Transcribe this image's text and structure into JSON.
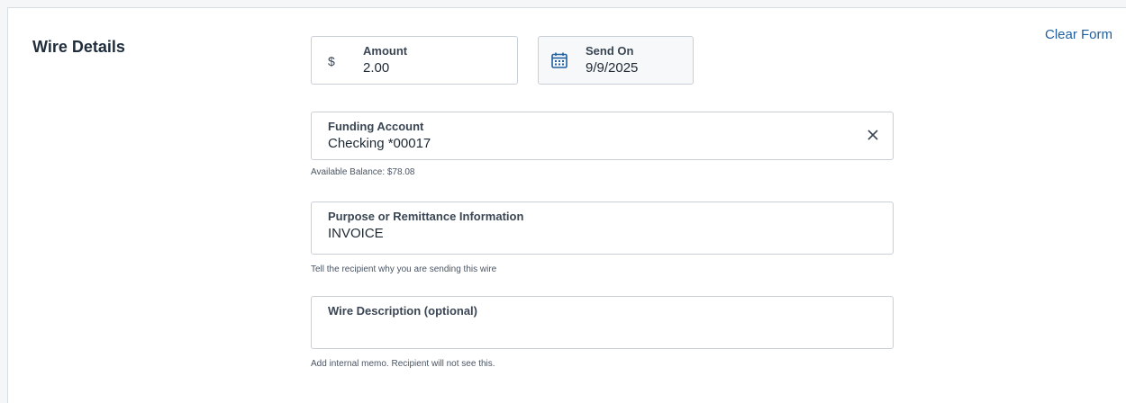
{
  "section": {
    "title": "Wire Details",
    "clear_label": "Clear Form"
  },
  "amount": {
    "prefix": "$",
    "label": "Amount",
    "value": "2.00"
  },
  "send_on": {
    "label": "Send On",
    "value": "9/9/2025",
    "icon": "calendar-icon"
  },
  "funding": {
    "label": "Funding Account",
    "value": "Checking *00017",
    "clear_icon": "close-icon",
    "helper": "Available Balance: $78.08"
  },
  "purpose": {
    "label": "Purpose or Remittance Information",
    "value": "INVOICE",
    "helper": "Tell the recipient why you are sending this wire"
  },
  "description": {
    "label": "Wire Description (optional)",
    "value": "",
    "helper": "Add internal memo. Recipient will not see this."
  }
}
